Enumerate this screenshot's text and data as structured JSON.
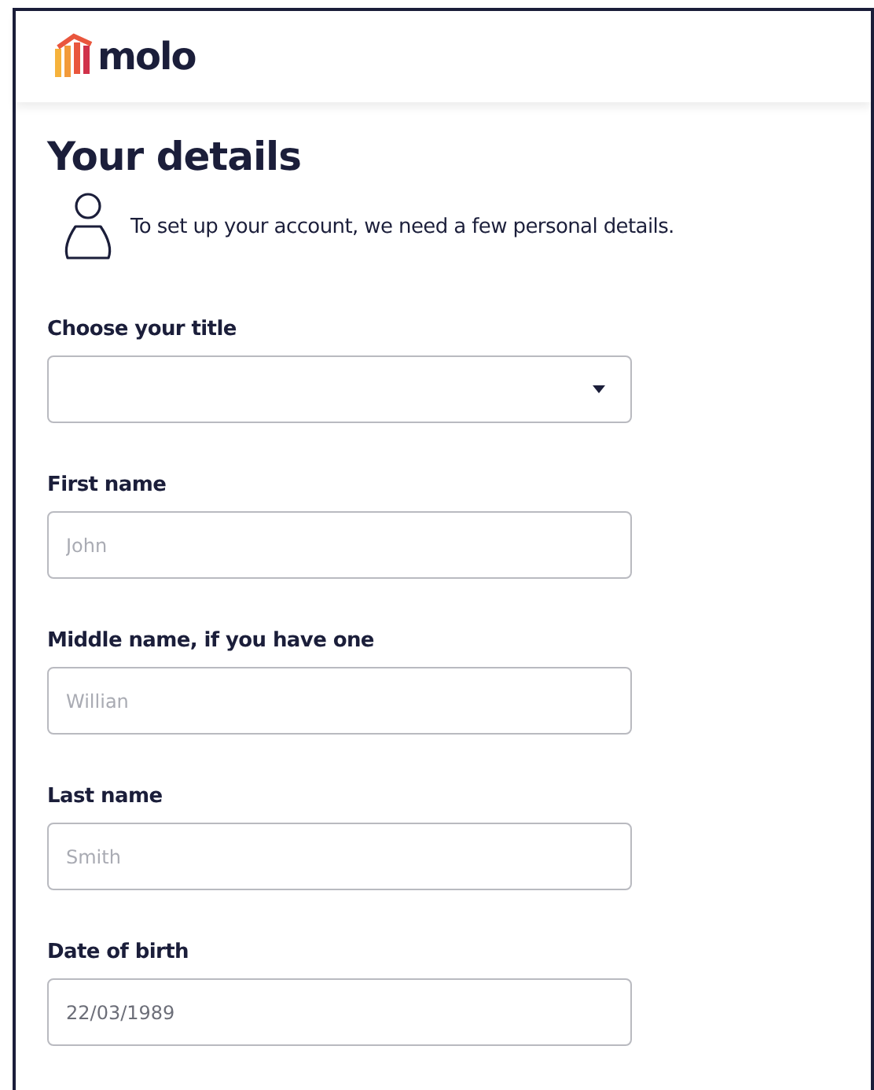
{
  "header": {
    "logo_text": "molo"
  },
  "page": {
    "heading": "Your details",
    "intro": "To set up your account, we need a few personal details."
  },
  "fields": [
    {
      "kind": "select",
      "label": "Choose your title"
    },
    {
      "kind": "text",
      "label": "First name",
      "placeholder": "John"
    },
    {
      "kind": "text",
      "label": "Middle name, if you have one",
      "placeholder": "Willian"
    },
    {
      "kind": "text",
      "label": "Last name",
      "placeholder": "Smith"
    },
    {
      "kind": "text",
      "label": "Date of birth",
      "value": "22/03/1989"
    }
  ]
}
